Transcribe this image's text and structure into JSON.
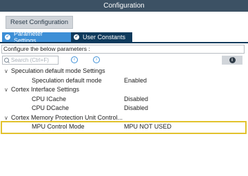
{
  "window": {
    "title": "Configuration"
  },
  "toolbar": {
    "reset_label": "Reset Configuration"
  },
  "tabs": [
    {
      "label": "Parameter Settings",
      "active": true,
      "icon": "check-icon"
    },
    {
      "label": "User Constants",
      "active": false,
      "icon": "check-icon"
    }
  ],
  "configure_text": "Configure the below parameters :",
  "search": {
    "placeholder": "Search (Ctrl+F)",
    "value": ""
  },
  "tree": {
    "groups": [
      {
        "label": "Speculation default mode Settings",
        "params": [
          {
            "name": "Speculation default mode",
            "value": "Enabled"
          }
        ]
      },
      {
        "label": "Cortex Interface Settings",
        "params": [
          {
            "name": "CPU ICache",
            "value": "Disabled"
          },
          {
            "name": "CPU DCache",
            "value": "Disabled"
          }
        ]
      },
      {
        "label": "Cortex Memory Protection Unit Control...",
        "params": [
          {
            "name": "MPU Control Mode",
            "value": "MPU NOT USED",
            "highlighted": true
          }
        ]
      }
    ]
  },
  "colors": {
    "titlebar": "#3c5164",
    "active_tab": "#3d8fd6",
    "inactive_tab": "#0f3a5c",
    "highlight": "#e2c22c"
  }
}
